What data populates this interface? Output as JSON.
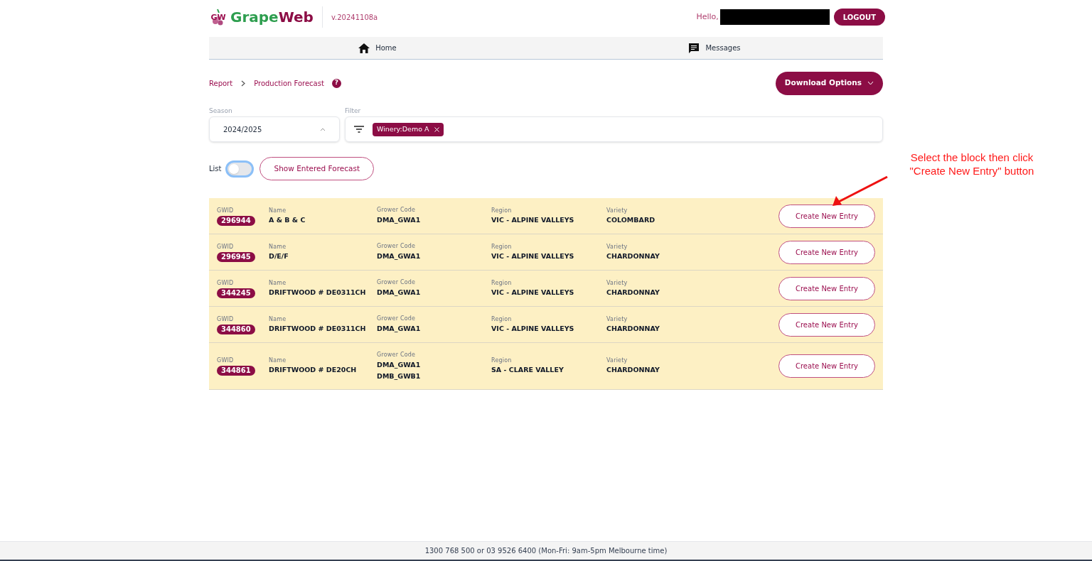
{
  "header": {
    "logo_mark": "GW",
    "brand_first": "Grape",
    "brand_second": "Web",
    "version": "v.20241108a",
    "greeting": "Hello,",
    "logout": "LOGOUT"
  },
  "nav": [
    {
      "label": "Home",
      "kind": "home"
    },
    {
      "label": "Messages",
      "kind": "messages"
    }
  ],
  "breadcrumb": [
    "Report",
    "Production Forecast"
  ],
  "help": "?",
  "download_button": "Download Options",
  "season": {
    "label": "Season",
    "value": "2024/2025"
  },
  "filter": {
    "label": "Filter",
    "chips": [
      "Winery:Demo A"
    ]
  },
  "list_toggle": {
    "label": "List",
    "on": false
  },
  "show_entered_button": "Show Entered Forecast",
  "rows": [
    {
      "gwid_label": "GWID",
      "gwid": "296944",
      "name_label": "Name",
      "name": "A & B & C",
      "grower_label": "Grower Code",
      "grower_codes": [
        "DMA_GWA1"
      ],
      "region_label": "Region",
      "region": "VIC - ALPINE VALLEYS",
      "variety_label": "Variety",
      "variety": "COLOMBARD",
      "button": "Create New Entry"
    },
    {
      "gwid_label": "GWID",
      "gwid": "296945",
      "name_label": "Name",
      "name": "D/E/F",
      "grower_label": "Grower Code",
      "grower_codes": [
        "DMA_GWA1"
      ],
      "region_label": "Region",
      "region": "VIC - ALPINE VALLEYS",
      "variety_label": "Variety",
      "variety": "CHARDONNAY",
      "button": "Create New Entry"
    },
    {
      "gwid_label": "GWID",
      "gwid": "344245",
      "name_label": "Name",
      "name": "DRIFTWOOD # DE0311CH",
      "grower_label": "Grower Code",
      "grower_codes": [
        "DMA_GWA1"
      ],
      "region_label": "Region",
      "region": "VIC - ALPINE VALLEYS",
      "variety_label": "Variety",
      "variety": "CHARDONNAY",
      "button": "Create New Entry"
    },
    {
      "gwid_label": "GWID",
      "gwid": "344860",
      "name_label": "Name",
      "name": "DRIFTWOOD # DE0311CH",
      "grower_label": "Grower Code",
      "grower_codes": [
        "DMA_GWA1"
      ],
      "region_label": "Region",
      "region": "VIC - ALPINE VALLEYS",
      "variety_label": "Variety",
      "variety": "CHARDONNAY",
      "button": "Create New Entry"
    },
    {
      "gwid_label": "GWID",
      "gwid": "344861",
      "name_label": "Name",
      "name": "DRIFTWOOD # DE20CH",
      "grower_label": "Grower Code",
      "grower_codes": [
        "DMA_GWA1",
        "DMB_GWB1"
      ],
      "region_label": "Region",
      "region": "SA - CLARE VALLEY",
      "variety_label": "Variety",
      "variety": "CHARDONNAY",
      "button": "Create New Entry"
    }
  ],
  "annotation": {
    "lines": [
      "Select the block then click",
      "\"Create New Entry\" button"
    ]
  },
  "footer": "1300 768 500 or 03 9526 6400 (Mon-Fri: 9am-5pm Melbourne time)"
}
